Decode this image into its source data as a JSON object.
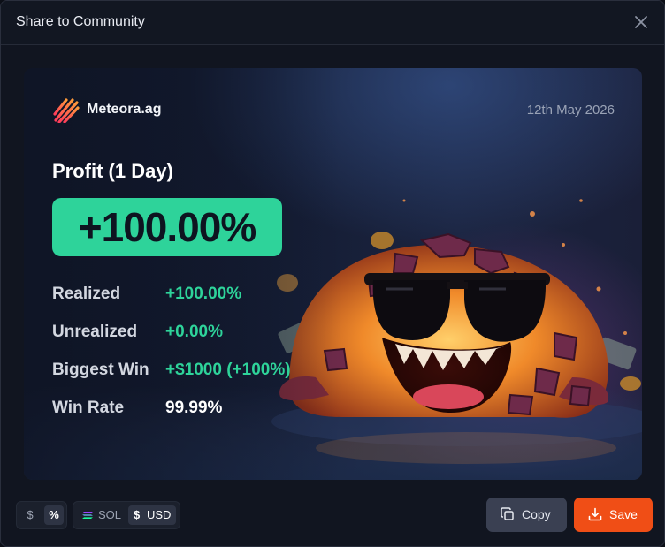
{
  "modal": {
    "title": "Share to Community"
  },
  "card": {
    "brand_name": "Meteora.ag",
    "date": "12th May 2026",
    "profit_label": "Profit (1 Day)",
    "profit_value": "+100.00%",
    "stats": [
      {
        "label": "Realized",
        "value": "+100.00%"
      },
      {
        "label": "Unrealized",
        "value": "+0.00%"
      },
      {
        "label": "Biggest Win",
        "value": "+$1000 (+100%)"
      },
      {
        "label": "Win Rate",
        "value": "99.99%"
      }
    ],
    "illustration": "cartoon-creature-with-sunglasses-in-water"
  },
  "footer": {
    "display_mode": {
      "options": [
        "$",
        "%"
      ],
      "selected": "%"
    },
    "currency": {
      "sol_label": "SOL",
      "usd_sign": "$",
      "usd_label": "USD",
      "selected": "USD"
    },
    "copy_label": "Copy",
    "save_label": "Save"
  },
  "colors": {
    "accent_green": "#2ed39a",
    "save_orange": "#f04e16",
    "background": "#111520"
  },
  "icons": {
    "close": "close-icon",
    "brand": "meteora-logo",
    "sol": "solana-icon",
    "copy": "copy-icon",
    "save": "download-icon"
  }
}
